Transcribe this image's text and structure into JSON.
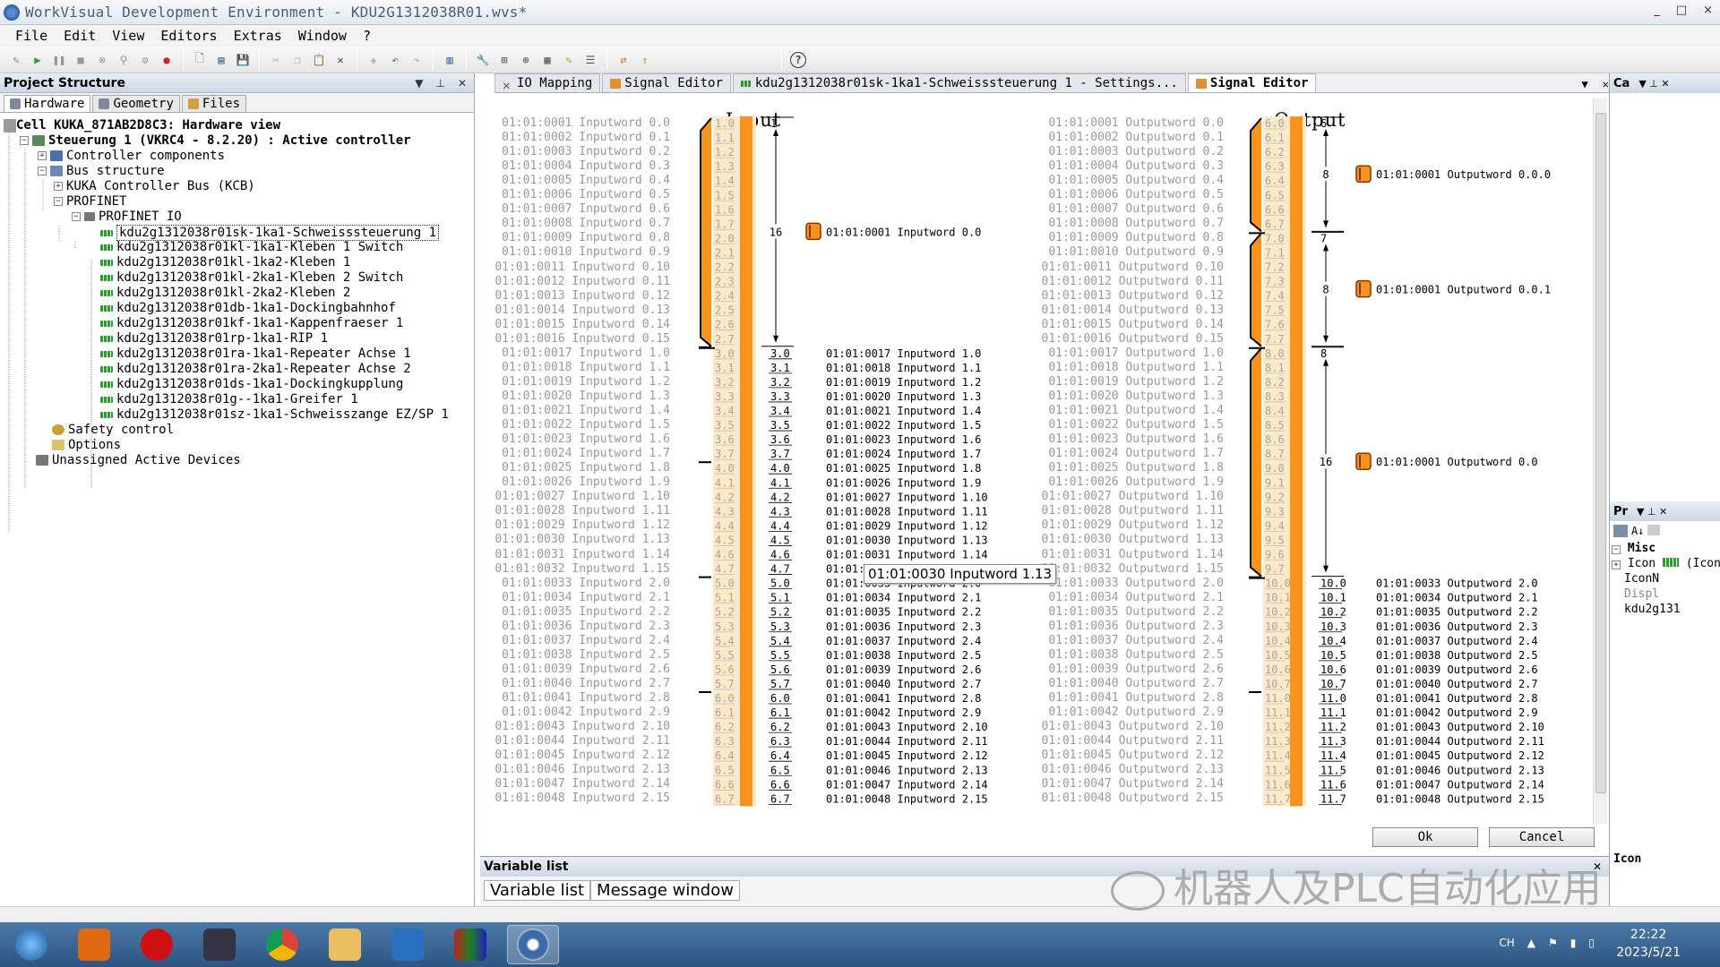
{
  "window": {
    "title": "WorkVisual Development Environment - KDU2G1312038R01.wvs*",
    "controls": [
      "_",
      "□",
      "×"
    ]
  },
  "menu": [
    "File",
    "Edit",
    "View",
    "Editors",
    "Extras",
    "Window",
    "?"
  ],
  "project_structure": {
    "title": "Project Structure",
    "tabs": [
      "Hardware",
      "Geometry",
      "Files"
    ],
    "tree": [
      {
        "label": "Cell KUKA_871AB2D8C3: Hardware view",
        "bold": true
      },
      {
        "label": "Steuerung 1 (VKRC4 - 8.2.20) : Active controller",
        "bold": true
      },
      {
        "label": "Controller components"
      },
      {
        "label": "Bus structure"
      },
      {
        "label": "KUKA Controller Bus (KCB)"
      },
      {
        "label": "PROFINET"
      },
      {
        "label": "PROFINET IO"
      },
      {
        "label": "kdu2g1312038r01sk-1ka1-Schweisssteuerung 1"
      },
      {
        "label": "kdu2g1312038r01kl-1ka1-Kleben 1 Switch"
      },
      {
        "label": "kdu2g1312038r01kl-1ka2-Kleben 1"
      },
      {
        "label": "kdu2g1312038r01kl-2ka1-Kleben 2 Switch"
      },
      {
        "label": "kdu2g1312038r01kl-2ka2-Kleben 2"
      },
      {
        "label": "kdu2g1312038r01db-1ka1-Dockingbahnhof"
      },
      {
        "label": "kdu2g1312038r01kf-1ka1-Kappenfraeser 1"
      },
      {
        "label": "kdu2g1312038r01rp-1ka1-RIP 1"
      },
      {
        "label": "kdu2g1312038r01ra-1ka1-Repeater Achse 1"
      },
      {
        "label": "kdu2g1312038r01ra-2ka1-Repeater Achse 2"
      },
      {
        "label": "kdu2g1312038r01ds-1ka1-Dockingkupplung"
      },
      {
        "label": "kdu2g1312038r01g--1ka1-Greifer 1"
      },
      {
        "label": "kdu2g1312038r01sz-1ka1-Schweisszange EZ/SP 1"
      },
      {
        "label": "Safety control"
      },
      {
        "label": "Options"
      },
      {
        "label": "Unassigned Active Devices"
      }
    ]
  },
  "editor_tabs": [
    "IO Mapping",
    "Signal Editor",
    "kdu2g1312038r01sk-1ka1-Schweisssteuerung 1 - Settings...",
    "Signal Editor"
  ],
  "signal_editor": {
    "input_title": "Input",
    "output_title": "Output",
    "input_rows": [
      "01:01:0001 Inputword 0.0",
      "01:01:0002 Inputword 0.1",
      "01:01:0003 Inputword 0.2",
      "01:01:0004 Inputword 0.3",
      "01:01:0005 Inputword 0.4",
      "01:01:0006 Inputword 0.5",
      "01:01:0007 Inputword 0.6",
      "01:01:0008 Inputword 0.7",
      "01:01:0009 Inputword 0.8",
      "01:01:0010 Inputword 0.9",
      "01:01:0011 Inputword 0.10",
      "01:01:0012 Inputword 0.11",
      "01:01:0013 Inputword 0.12",
      "01:01:0014 Inputword 0.13",
      "01:01:0015 Inputword 0.14",
      "01:01:0016 Inputword 0.15",
      "01:01:0017 Inputword 1.0",
      "01:01:0018 Inputword 1.1",
      "01:01:0019 Inputword 1.2",
      "01:01:0020 Inputword 1.3",
      "01:01:0021 Inputword 1.4",
      "01:01:0022 Inputword 1.5",
      "01:01:0023 Inputword 1.6",
      "01:01:0024 Inputword 1.7",
      "01:01:0025 Inputword 1.8",
      "01:01:0026 Inputword 1.9",
      "01:01:0027 Inputword 1.10",
      "01:01:0028 Inputword 1.11",
      "01:01:0029 Inputword 1.12",
      "01:01:0030 Inputword 1.13",
      "01:01:0031 Inputword 1.14",
      "01:01:0032 Inputword 1.15",
      "01:01:0033 Inputword 2.0",
      "01:01:0034 Inputword 2.1",
      "01:01:0035 Inputword 2.2",
      "01:01:0036 Inputword 2.3",
      "01:01:0037 Inputword 2.4",
      "01:01:0038 Inputword 2.5",
      "01:01:0039 Inputword 2.6",
      "01:01:0040 Inputword 2.7",
      "01:01:0041 Inputword 2.8",
      "01:01:0042 Inputword 2.9",
      "01:01:0043 Inputword 2.10",
      "01:01:0044 Inputword 2.11",
      "01:01:0045 Inputword 2.12",
      "01:01:0046 Inputword 2.13",
      "01:01:0047 Inputword 2.14",
      "01:01:0048 Inputword 2.15"
    ],
    "input_bits": [
      "1.0",
      "1.1",
      "1.2",
      "1.3",
      "1.4",
      "1.5",
      "1.6",
      "1.7",
      "2.0",
      "2.1",
      "2.2",
      "2.3",
      "2.4",
      "2.5",
      "2.6",
      "2.7",
      "3.0",
      "3.1",
      "3.2",
      "3.3",
      "3.4",
      "3.5",
      "3.6",
      "3.7",
      "4.0",
      "4.1",
      "4.2",
      "4.3",
      "4.4",
      "4.5",
      "4.6",
      "4.7",
      "5.0",
      "5.1",
      "5.2",
      "5.3",
      "5.4",
      "5.5",
      "5.6",
      "5.7",
      "6.0",
      "6.1",
      "6.2",
      "6.3",
      "6.4",
      "6.5",
      "6.6",
      "6.7"
    ],
    "input_group_label": "16",
    "input_group_first": "1",
    "input_group_map": "01:01:0001 Inputword 0.0",
    "output_rows": [
      "01:01:0001 Outputword 0.0",
      "01:01:0002 Outputword 0.1",
      "01:01:0003 Outputword 0.2",
      "01:01:0004 Outputword 0.3",
      "01:01:0005 Outputword 0.4",
      "01:01:0006 Outputword 0.5",
      "01:01:0007 Outputword 0.6",
      "01:01:0008 Outputword 0.7",
      "01:01:0009 Outputword 0.8",
      "01:01:0010 Outputword 0.9",
      "01:01:0011 Outputword 0.10",
      "01:01:0012 Outputword 0.11",
      "01:01:0013 Outputword 0.12",
      "01:01:0014 Outputword 0.13",
      "01:01:0015 Outputword 0.14",
      "01:01:0016 Outputword 0.15",
      "01:01:0017 Outputword 1.0",
      "01:01:0018 Outputword 1.1",
      "01:01:0019 Outputword 1.2",
      "01:01:0020 Outputword 1.3",
      "01:01:0021 Outputword 1.4",
      "01:01:0022 Outputword 1.5",
      "01:01:0023 Outputword 1.6",
      "01:01:0024 Outputword 1.7",
      "01:01:0025 Outputword 1.8",
      "01:01:0026 Outputword 1.9",
      "01:01:0027 Outputword 1.10",
      "01:01:0028 Outputword 1.11",
      "01:01:0029 Outputword 1.12",
      "01:01:0030 Outputword 1.13",
      "01:01:0031 Outputword 1.14",
      "01:01:0032 Outputword 1.15",
      "01:01:0033 Outputword 2.0",
      "01:01:0034 Outputword 2.1",
      "01:01:0035 Outputword 2.2",
      "01:01:0036 Outputword 2.3",
      "01:01:0037 Outputword 2.4",
      "01:01:0038 Outputword 2.5",
      "01:01:0039 Outputword 2.6",
      "01:01:0040 Outputword 2.7",
      "01:01:0041 Outputword 2.8",
      "01:01:0042 Outputword 2.9",
      "01:01:0043 Outputword 2.10",
      "01:01:0044 Outputword 2.11",
      "01:01:0045 Outputword 2.12",
      "01:01:0046 Outputword 2.13",
      "01:01:0047 Outputword 2.14",
      "01:01:0048 Outputword 2.15"
    ],
    "output_bits": [
      "6.0",
      "6.1",
      "6.2",
      "6.3",
      "6.4",
      "6.5",
      "6.6",
      "6.7",
      "7.0",
      "7.1",
      "7.2",
      "7.3",
      "7.4",
      "7.5",
      "7.6",
      "7.7",
      "8.0",
      "8.1",
      "8.2",
      "8.3",
      "8.4",
      "8.5",
      "8.6",
      "8.7",
      "9.0",
      "9.1",
      "9.2",
      "9.3",
      "9.4",
      "9.5",
      "9.6",
      "9.7",
      "10.0",
      "10.1",
      "10.2",
      "10.3",
      "10.4",
      "10.5",
      "10.6",
      "10.7",
      "11.0",
      "11.1",
      "11.2",
      "11.3",
      "11.4",
      "11.5",
      "11.6",
      "11.7"
    ],
    "output_groups": [
      {
        "first": "6",
        "len": "8",
        "map": "01:01:0001 Outputword 0.0.0"
      },
      {
        "first": "7",
        "len": "8",
        "map": "01:01:0001 Outputword 0.0.1"
      },
      {
        "first": "8",
        "len": "16",
        "map": "01:01:0001 Outputword 0.0"
      }
    ],
    "tooltip": "01:01:0030 Inputword 1.13",
    "ok_label": "Ok",
    "cancel_label": "Cancel"
  },
  "right_panels": {
    "top_title": "Ca",
    "mid_title": "Pr",
    "misc": "Misc",
    "icon_label": "Icon",
    "icon_value": "(Icon",
    "iconn": "IconN",
    "displ": "Displ",
    "displ_value": "kdu2g131",
    "bottom_label": "Icon"
  },
  "variable_list": {
    "title": "Variable list",
    "tabs": [
      "Variable list",
      "Message window"
    ]
  },
  "watermark": "机器人及PLC自动化应用",
  "taskbar": {
    "lang": "CH",
    "time": "22:22",
    "date": "2023/5/21"
  },
  "colors": {
    "accent_orange": "#f7941d",
    "cream": "#fbe9c8",
    "title_text": "#4a5d78"
  }
}
